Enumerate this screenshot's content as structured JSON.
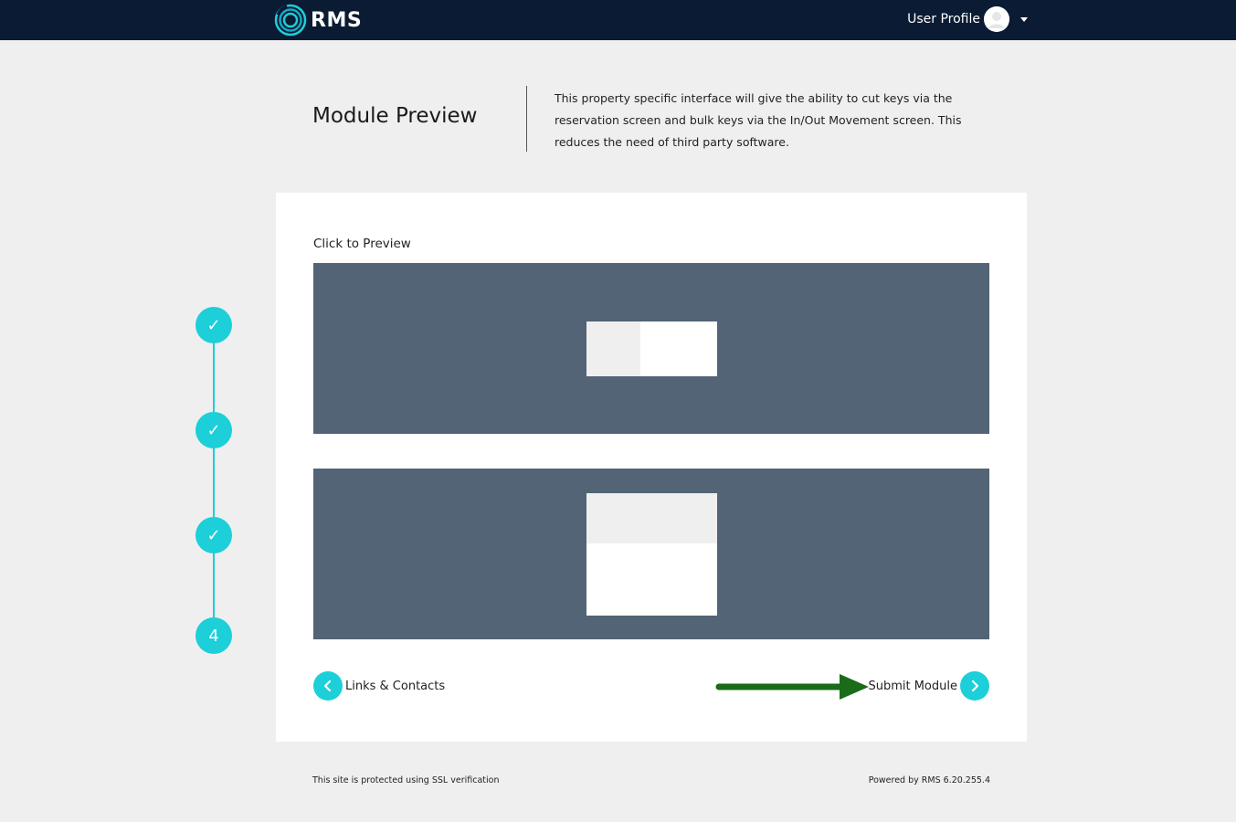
{
  "app": {
    "logo_text": "RMS",
    "accent_color": "#1ccfd8",
    "header_color": "#0b1b33"
  },
  "header": {
    "user_profile_label": "User Profile"
  },
  "page": {
    "title": "Module Preview",
    "description": "This property specific interface will give the ability to cut keys via the reservation screen and bulk keys via the In/Out Movement screen. This reduces the need of third party software."
  },
  "stepper": {
    "steps": [
      {
        "label": "✓",
        "state": "complete"
      },
      {
        "label": "✓",
        "state": "complete"
      },
      {
        "label": "✓",
        "state": "complete"
      },
      {
        "label": "4",
        "state": "current"
      }
    ]
  },
  "preview": {
    "label": "Click to Preview",
    "panel_color": "#526475"
  },
  "nav": {
    "back_label": "Links & Contacts",
    "next_label": "Submit Module",
    "annotation_arrow_color": "#1a6b1a"
  },
  "footer": {
    "left_text": "This site is protected using SSL verification",
    "right_text": "Powered by RMS 6.20.255.4"
  }
}
